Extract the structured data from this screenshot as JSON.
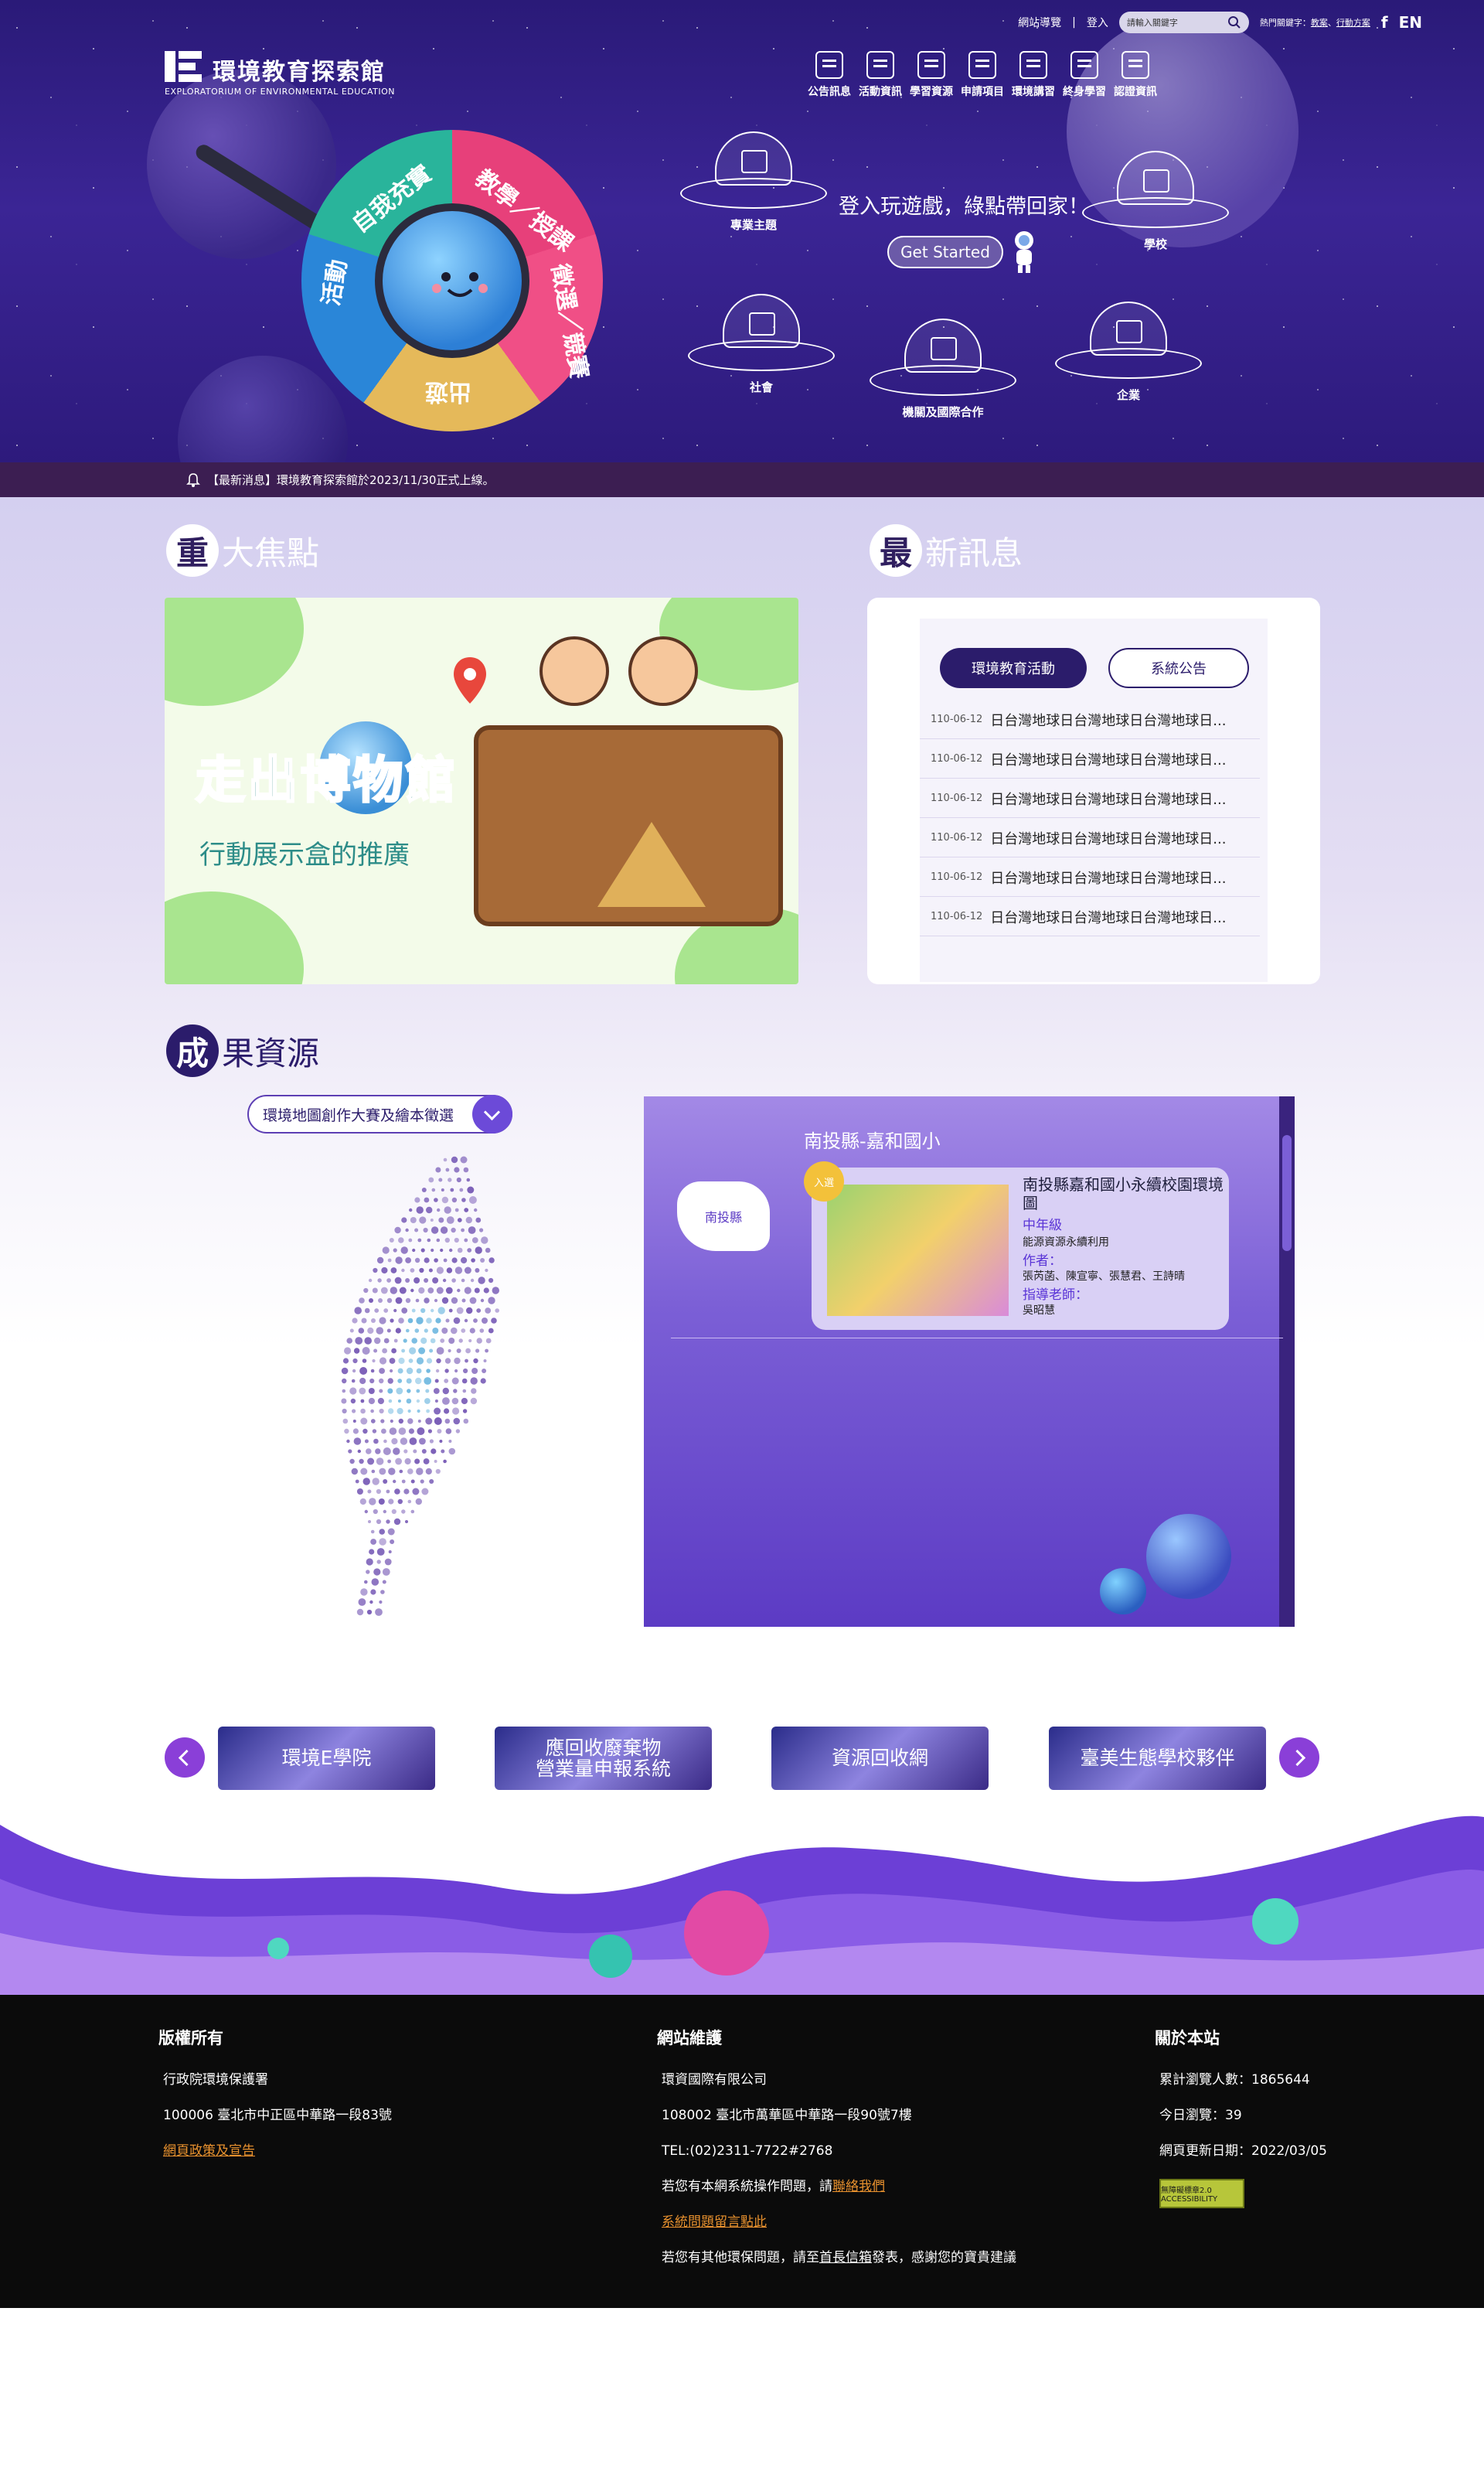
{
  "header": {
    "topbar": {
      "sitemap": "網站導覽",
      "separator": "|",
      "login": "登入",
      "search_placeholder": "請輸入關鍵字",
      "hot_label": "熱門關鍵字：",
      "hot_1": "教案",
      "hot_sep": "、",
      "hot_2": "行動方案",
      "facebook": "f",
      "lang": "EN"
    },
    "logo": {
      "name": "環境教育探索館",
      "subtitle": "EXPLORATORIUM OF ENVIRONMENTAL EDUCATION"
    },
    "nav": [
      {
        "label": "公告訊息"
      },
      {
        "label": "活動資訊"
      },
      {
        "label": "學習資源"
      },
      {
        "label": "申請項目"
      },
      {
        "label": "環境講習"
      },
      {
        "label": "終身學習"
      },
      {
        "label": "認證資訊"
      }
    ]
  },
  "hero": {
    "wheel": [
      "自我充實",
      "教學／授課",
      "徵選／競賽",
      "出遊",
      "活動"
    ],
    "ufos": [
      {
        "label": "專業主題"
      },
      {
        "label": "學校"
      },
      {
        "label": "社會"
      },
      {
        "label": "機關及國際合作"
      },
      {
        "label": "企業"
      }
    ],
    "cta_text": "登入玩遊戲，綠點帶回家！",
    "cta_button": "Get Started",
    "news_ticker": "【最新消息】環境教育探索館於2023/11/30正式上線。"
  },
  "focus": {
    "title_char": "重",
    "title_rest": "大焦點",
    "banner_title": "走出博物館",
    "banner_sub": "行動展示盒的推廣"
  },
  "news": {
    "title_char": "最",
    "title_rest": "新訊息",
    "tabs": [
      "環境教育活動",
      "系統公告"
    ],
    "items": [
      {
        "date": "110-06-12",
        "text": "日台灣地球日台灣地球日台灣地球日..."
      },
      {
        "date": "110-06-12",
        "text": "日台灣地球日台灣地球日台灣地球日..."
      },
      {
        "date": "110-06-12",
        "text": "日台灣地球日台灣地球日台灣地球日..."
      },
      {
        "date": "110-06-12",
        "text": "日台灣地球日台灣地球日台灣地球日..."
      },
      {
        "date": "110-06-12",
        "text": "日台灣地球日台灣地球日台灣地球日..."
      },
      {
        "date": "110-06-12",
        "text": "日台灣地球日台灣地球日台灣地球日..."
      }
    ]
  },
  "results": {
    "title_char": "成",
    "title_rest": "果資源",
    "select_value": "環境地圖創作大賽及繪本徵選",
    "region_title": "南投縣-嘉和國小",
    "county_label": "南投縣",
    "badge": "入選",
    "card": {
      "title": "南投縣嘉和國小永續校園環境圖",
      "grade": "中年級",
      "category": "能源資源永續利用",
      "authors_label": "作者：",
      "authors": "張芮菡、陳宣寧、張慧君、王詩晴",
      "advisor_label": "指導老師：",
      "advisor": "吳昭慧"
    }
  },
  "links": [
    {
      "label": "環境E學院"
    },
    {
      "label": "應回收廢棄物\n營業量申報系統"
    },
    {
      "label": "資源回收網"
    },
    {
      "label": "臺美生態學校夥伴"
    }
  ],
  "footer": {
    "copyright": {
      "heading": "版權所有",
      "org": "行政院環境保護署",
      "address": "100006 臺北市中正區中華路一段83號",
      "policy_link": "網頁政策及宣告"
    },
    "maintenance": {
      "heading": "網站維護",
      "company": "環資國際有限公司",
      "address": "108002 臺北市萬華區中華路一段90號7樓",
      "tel": "TEL:(02)2311-7722#2768",
      "contact_pre": "若您有本網系統操作問題，請",
      "contact_link": "聯絡我們",
      "feedback_link": "系統問題留言點此",
      "mail_pre": "若您有其他環保問題，請至",
      "mail_link": "首長信箱",
      "mail_post": "發表，感謝您的寶貴建議"
    },
    "about": {
      "heading": "關於本站",
      "total_views": "累計瀏覽人數：1865644",
      "today_views": "今日瀏覽：39",
      "updated": "網頁更新日期：2022/03/05",
      "a11y_badge": "無障礙標章2.0 ACCESSIBILITY"
    }
  },
  "colors": {
    "hero_bg": "#2a1a78",
    "accent_dark": "#2b1c6b",
    "accent_purple": "#6c4ad8",
    "footer_bg": "#0b0b0b",
    "footer_link": "#e8912e"
  }
}
